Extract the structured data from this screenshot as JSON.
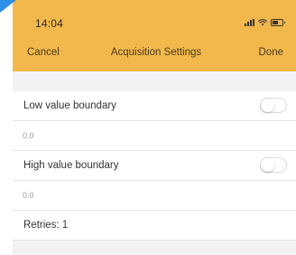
{
  "status_bar": {
    "time": "14:04",
    "icons": [
      "signal-icon",
      "wifi-icon",
      "battery-icon"
    ]
  },
  "nav": {
    "cancel_label": "Cancel",
    "title": "Acquisition Settings",
    "done_label": "Done"
  },
  "settings": {
    "low_boundary": {
      "label": "Low value boundary",
      "enabled": false,
      "value": "0.0"
    },
    "high_boundary": {
      "label": "High value boundary",
      "enabled": false,
      "value": "0.0"
    },
    "retries_label": "Retries: 1"
  },
  "colors": {
    "header_background": "#f2b84b",
    "page_background": "#f2f2f4",
    "corner_mark": "#2f8fe6"
  }
}
